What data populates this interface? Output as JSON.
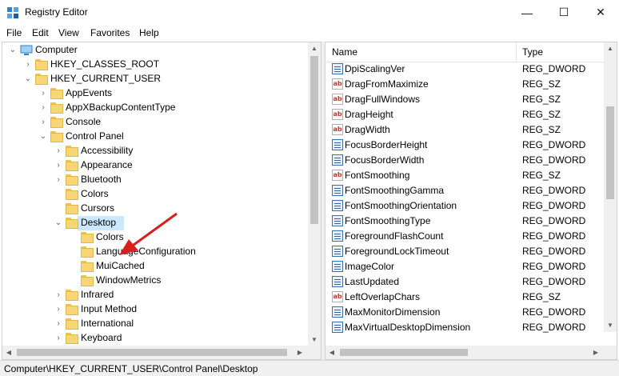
{
  "window": {
    "title": "Registry Editor",
    "minimize_glyph": "—",
    "maximize_glyph": "☐",
    "close_glyph": "✕"
  },
  "menu": [
    "File",
    "Edit",
    "View",
    "Favorites",
    "Help"
  ],
  "tree": [
    {
      "label": "Computer",
      "level": 0,
      "expander": "expanded",
      "icon": "computer-icon"
    },
    {
      "label": "HKEY_CLASSES_ROOT",
      "level": 1,
      "expander": "collapsed",
      "icon": "folder-icon"
    },
    {
      "label": "HKEY_CURRENT_USER",
      "level": 1,
      "expander": "expanded",
      "icon": "folder-icon"
    },
    {
      "label": "AppEvents",
      "level": 2,
      "expander": "collapsed",
      "icon": "folder-icon"
    },
    {
      "label": "AppXBackupContentType",
      "level": 2,
      "expander": "collapsed",
      "icon": "folder-icon"
    },
    {
      "label": "Console",
      "level": 2,
      "expander": "collapsed",
      "icon": "folder-icon"
    },
    {
      "label": "Control Panel",
      "level": 2,
      "expander": "expanded",
      "icon": "folder-icon"
    },
    {
      "label": "Accessibility",
      "level": 3,
      "expander": "collapsed",
      "icon": "folder-icon"
    },
    {
      "label": "Appearance",
      "level": 3,
      "expander": "collapsed",
      "icon": "folder-icon"
    },
    {
      "label": "Bluetooth",
      "level": 3,
      "expander": "collapsed",
      "icon": "folder-icon"
    },
    {
      "label": "Colors",
      "level": 3,
      "expander": "none",
      "icon": "folder-icon"
    },
    {
      "label": "Cursors",
      "level": 3,
      "expander": "none",
      "icon": "folder-icon"
    },
    {
      "label": "Desktop",
      "level": 3,
      "expander": "expanded",
      "icon": "folder-icon",
      "selected": true
    },
    {
      "label": "Colors",
      "level": 4,
      "expander": "none",
      "icon": "folder-icon"
    },
    {
      "label": "LanguageConfiguration",
      "level": 4,
      "expander": "none",
      "icon": "folder-icon"
    },
    {
      "label": "MuiCached",
      "level": 4,
      "expander": "none",
      "icon": "folder-icon"
    },
    {
      "label": "WindowMetrics",
      "level": 4,
      "expander": "none",
      "icon": "folder-icon"
    },
    {
      "label": "Infrared",
      "level": 3,
      "expander": "collapsed",
      "icon": "folder-icon"
    },
    {
      "label": "Input Method",
      "level": 3,
      "expander": "collapsed",
      "icon": "folder-icon"
    },
    {
      "label": "International",
      "level": 3,
      "expander": "collapsed",
      "icon": "folder-icon"
    },
    {
      "label": "Keyboard",
      "level": 3,
      "expander": "collapsed",
      "icon": "folder-icon"
    }
  ],
  "values_table": {
    "columns": [
      "Name",
      "Type"
    ],
    "rows": [
      {
        "name": "DpiScalingVer",
        "type": "REG_DWORD"
      },
      {
        "name": "DragFromMaximize",
        "type": "REG_SZ"
      },
      {
        "name": "DragFullWindows",
        "type": "REG_SZ"
      },
      {
        "name": "DragHeight",
        "type": "REG_SZ"
      },
      {
        "name": "DragWidth",
        "type": "REG_SZ"
      },
      {
        "name": "FocusBorderHeight",
        "type": "REG_DWORD"
      },
      {
        "name": "FocusBorderWidth",
        "type": "REG_DWORD"
      },
      {
        "name": "FontSmoothing",
        "type": "REG_SZ"
      },
      {
        "name": "FontSmoothingGamma",
        "type": "REG_DWORD"
      },
      {
        "name": "FontSmoothingOrientation",
        "type": "REG_DWORD"
      },
      {
        "name": "FontSmoothingType",
        "type": "REG_DWORD"
      },
      {
        "name": "ForegroundFlashCount",
        "type": "REG_DWORD"
      },
      {
        "name": "ForegroundLockTimeout",
        "type": "REG_DWORD"
      },
      {
        "name": "ImageColor",
        "type": "REG_DWORD"
      },
      {
        "name": "LastUpdated",
        "type": "REG_DWORD"
      },
      {
        "name": "LeftOverlapChars",
        "type": "REG_SZ"
      },
      {
        "name": "MaxMonitorDimension",
        "type": "REG_DWORD"
      },
      {
        "name": "MaxVirtualDesktopDimension",
        "type": "REG_DWORD"
      }
    ]
  },
  "status_bar": {
    "path": "Computer\\HKEY_CURRENT_USER\\Control Panel\\Desktop"
  },
  "icons": {
    "string_value": "ab",
    "expanded": "⌄",
    "collapsed": "›",
    "scroll_up": "▲",
    "scroll_down": "▼",
    "scroll_left": "◀",
    "scroll_right": "▶"
  },
  "colors": {
    "selection": "#cce8ff",
    "annotation_arrow": "#d9201f",
    "folder": "#f7d675"
  }
}
